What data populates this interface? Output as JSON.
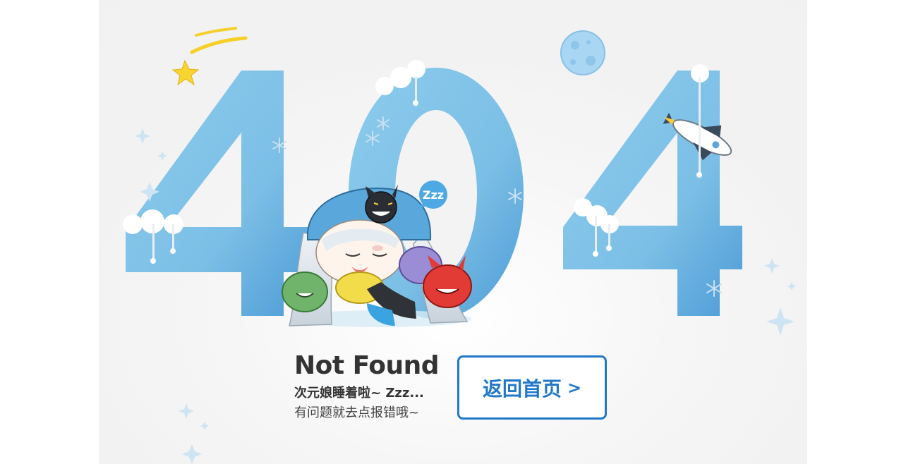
{
  "error": {
    "code": "404",
    "title": "Not Found",
    "subtitle": "次元娘睡着啦~ Zzz...",
    "hint": "有问题就去点报错哦~"
  },
  "actions": {
    "home_button_label": "返回首页",
    "home_button_arrow": ">"
  },
  "illustration": {
    "speech_bubble": "Zzz",
    "mascot_icon": "sleeping-mascot-icon",
    "decor_icons": [
      "shooting-star-icon",
      "moon-icon",
      "rocket-icon",
      "cloud-icon",
      "snowflake-icon",
      "sparkle-icon"
    ]
  },
  "colors": {
    "digit_blue": "#7cbfe6",
    "digit_blue_dark": "#4d9bd6",
    "accent_blue": "#2178c8",
    "text_dark": "#333333",
    "background": "#f2f2f2"
  }
}
